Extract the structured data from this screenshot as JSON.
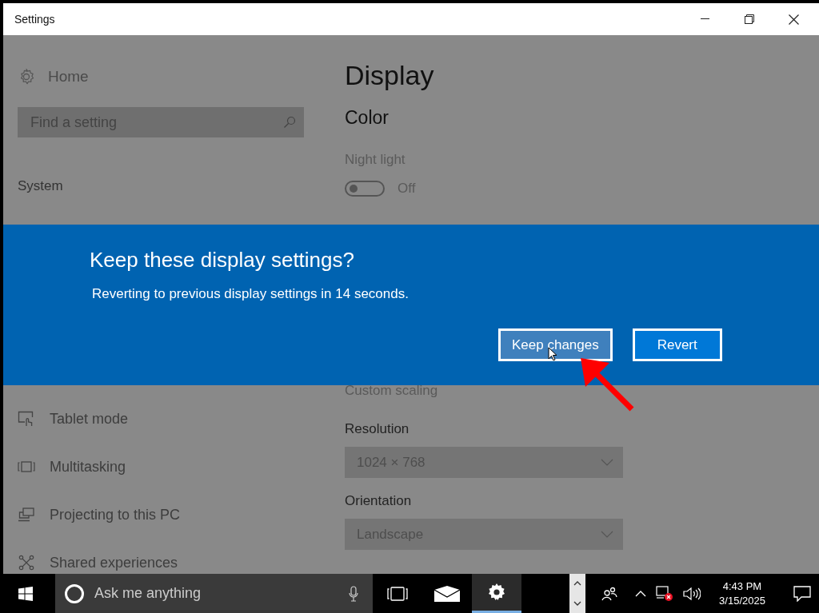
{
  "window": {
    "title": "Settings"
  },
  "sidebar": {
    "home": "Home",
    "search": {
      "placeholder": "Find a setting"
    },
    "section": "System",
    "items": [
      {
        "kind": "tablet",
        "label": "Tablet mode"
      },
      {
        "kind": "multitask",
        "label": "Multitasking"
      },
      {
        "kind": "project",
        "label": "Projecting to this PC"
      },
      {
        "kind": "shared",
        "label": "Shared experiences"
      }
    ]
  },
  "content": {
    "title": "Display",
    "section": "Color",
    "night_light": {
      "label": "Night light",
      "on": false,
      "state_text": "Off"
    },
    "custom_scaling": "Custom scaling",
    "dropdowns": [
      {
        "label": "Resolution",
        "value": "1024 × 768"
      },
      {
        "label": "Orientation",
        "value": "Landscape"
      }
    ]
  },
  "dialog": {
    "title": "Keep these display settings?",
    "message": "Reverting to previous display settings in 14 seconds.",
    "buttons": [
      {
        "label": "Keep changes",
        "hovered": true
      },
      {
        "label": "Revert",
        "hovered": false
      }
    ]
  },
  "taskbar": {
    "search": {
      "placeholder": "Ask me anything"
    },
    "apps": [
      {
        "kind": "taskview",
        "active": false
      },
      {
        "kind": "mail",
        "active": false
      },
      {
        "kind": "settings",
        "active": true
      }
    ],
    "time": "4:43 PM",
    "date": "3/15/2025"
  }
}
